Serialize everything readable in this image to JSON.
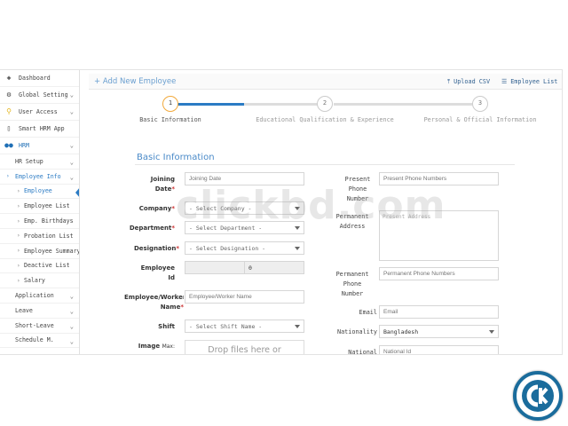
{
  "sidebar": {
    "items": [
      {
        "icon": "dashboard-icon",
        "label": "Dashboard",
        "chevron": ""
      },
      {
        "icon": "gear-icon",
        "label": "Global Setting",
        "chevron": "⌄"
      },
      {
        "icon": "key-icon",
        "label": "User Access",
        "chevron": "⌄"
      },
      {
        "icon": "phone-icon",
        "label": "Smart HRM App",
        "chevron": ""
      },
      {
        "icon": "users-icon",
        "label": "HRM",
        "chevron": "⌄"
      }
    ],
    "hrm_children": [
      {
        "label": "HR Setup",
        "chevron": "⌄"
      },
      {
        "label": "Employee Info",
        "chevron": "⌄"
      }
    ],
    "employee_info_children": [
      "Employee",
      "Employee List",
      "Emp. Birthdays",
      "Probation List",
      "Employee Summary",
      "Deactive List",
      "Salary"
    ],
    "other_items": [
      {
        "label": "Application",
        "chevron": "⌄"
      },
      {
        "label": "Leave",
        "chevron": "⌄"
      },
      {
        "label": "Short-Leave",
        "chevron": "⌄"
      },
      {
        "label": "Schedule M.",
        "chevron": "⌄"
      }
    ]
  },
  "header": {
    "title": "Add New Employee",
    "upload_csv": "Upload CSV",
    "employee_list": "Employee List"
  },
  "stepper": {
    "steps": [
      {
        "number": "1",
        "label": "Basic Information"
      },
      {
        "number": "2",
        "label": "Educational Qualification & Experience"
      },
      {
        "number": "3",
        "label": "Personal & Official Information"
      }
    ]
  },
  "section_title": "Basic Information",
  "form_left": {
    "joining_date": {
      "label1": "Joining",
      "label2": "Date",
      "placeholder": "Joining Date"
    },
    "company": {
      "label": "Company",
      "value": "- Select Company -"
    },
    "department": {
      "label": "Department",
      "value": "- Select Department -"
    },
    "designation": {
      "label": "Designation",
      "value": "- Select Designation -"
    },
    "employee_id": {
      "label1": "Employee",
      "label2": "Id",
      "value": "0"
    },
    "employee_name": {
      "label1": "Employee/Worker",
      "label2": "Name",
      "placeholder": "Employee/Worker Name"
    },
    "shift": {
      "label": "Shift",
      "value": "- Select Shift Name -"
    },
    "image": {
      "label": "Image",
      "label_suffix": "Max:",
      "drop_text": "Drop files here or"
    }
  },
  "form_right": {
    "present_phone": {
      "label1": "Present",
      "label2": "Phone",
      "label3": "Number",
      "placeholder": "Present Phone Numbers"
    },
    "permanent_address": {
      "label1": "Permanent",
      "label2": "Address",
      "placeholder": "Present Address"
    },
    "permanent_phone": {
      "label1": "Permanent",
      "label2": "Phone",
      "label3": "Number",
      "placeholder": "Permanent Phone Numbers"
    },
    "email": {
      "label": "Email",
      "placeholder": "Email"
    },
    "nationality": {
      "label": "Nationality",
      "value": "Bangladesh"
    },
    "national_id": {
      "label": "National",
      "placeholder": "National Id"
    }
  },
  "watermark": "clickbd.com",
  "colors": {
    "accent": "#2b7bc4",
    "step_active": "#f2a93b",
    "logo": "#1a6c9c"
  }
}
